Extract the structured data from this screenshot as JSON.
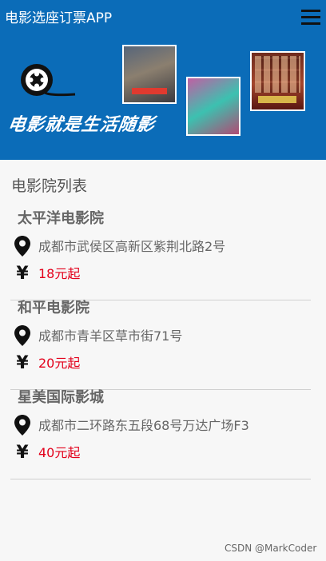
{
  "app": {
    "title": "电影选座订票APP"
  },
  "banner": {
    "slogan": "电影就是生活随影"
  },
  "list": {
    "title": "电影院列表",
    "items": [
      {
        "name": "太平洋电影院",
        "address": "成都市武侯区高新区紫荆北路2号",
        "price": "18元起"
      },
      {
        "name": "和平电影院",
        "address": "成都市青羊区草市街71号",
        "price": "20元起"
      },
      {
        "name": "星美国际影城",
        "address": "成都市二环路东五段68号万达广场F3",
        "price": "40元起"
      }
    ]
  },
  "icons": {
    "price_symbol": "¥",
    "menu": "menu-icon",
    "location": "location-pin-icon",
    "logo": "film-reel-icon"
  },
  "colors": {
    "header_bg": "#0b6cb8",
    "price": "#e3001b",
    "background": "#f7f7f7"
  },
  "footer": {
    "watermark": "CSDN @MarkCoder"
  }
}
